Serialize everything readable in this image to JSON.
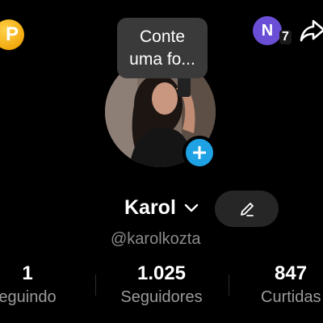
{
  "header": {
    "coin_icon": "coin-icon",
    "coin_glyph": "P",
    "avatar_initial": "N",
    "notification_count": "7",
    "share_icon": "share-icon"
  },
  "photo_prompt": {
    "line1": "Conte",
    "line2": "uma fo..."
  },
  "profile": {
    "name": "Karol",
    "username": "@karolkozta"
  },
  "stats": [
    {
      "value": "1",
      "label": "eguindo"
    },
    {
      "value": "1.025",
      "label": "Seguidores"
    },
    {
      "value": "847",
      "label": "Curtidas"
    }
  ],
  "colors": {
    "background": "#000000",
    "accent_blue": "#1fa2e4",
    "avatar_purple": "#6a4fd6",
    "coin_gold": "#f2a90d",
    "muted_text": "#9a9a9a"
  }
}
